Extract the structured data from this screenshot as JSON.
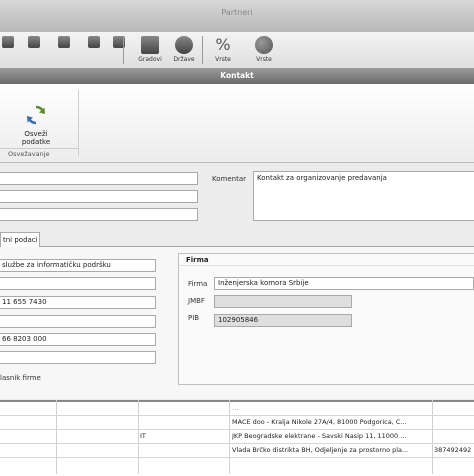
{
  "background_app": {
    "title": "Partneri",
    "ribbon": [
      {
        "label": "",
        "icon": "button-icon"
      },
      {
        "label": "",
        "icon": "button-icon"
      },
      {
        "label": "",
        "icon": "button-icon"
      },
      {
        "label": "",
        "icon": "button-icon"
      },
      {
        "label": "",
        "icon": "button-icon"
      },
      {
        "label": "Gradovi",
        "icon": "buildings-icon"
      },
      {
        "label": "Države",
        "icon": "globe-icon"
      },
      {
        "label": "Vrste",
        "icon": "percent-icon"
      },
      {
        "label": "Vrste",
        "icon": "people-icon"
      }
    ]
  },
  "dialog": {
    "title": "Kontakt",
    "ribbon": {
      "refresh_label": "Osveži podatke",
      "group_label": "Osvežavanje"
    },
    "top": {
      "komentar_label": "Komentar",
      "komentar_value": "Kontakt za organizovanje predavanja",
      "field1": "",
      "field2": "",
      "field3": ""
    },
    "tab": {
      "label": "tni podaci"
    },
    "left": {
      "f1": "službe za informatičku podršku",
      "f2": "",
      "f3": "11 655 7430",
      "f4": "",
      "f5": "66 8203 000",
      "f6": "",
      "footer_label": "lasnik firme"
    },
    "firma": {
      "heading": "Firma",
      "firma_label": "Firma",
      "firma_value": "Inženjerska komora Srbije",
      "jmbf_label": "JMBF",
      "jmbf_value": "",
      "pib_label": "PIB",
      "pib_value": "102905846"
    }
  },
  "grid": {
    "rows": [
      {
        "c3": "",
        "c4": "…",
        "c5": ""
      },
      {
        "c3": "",
        "c4": "MACE doo - Kralja Nikole 27A/4, 81000 Podgorica, C...",
        "c5": ""
      },
      {
        "c3": "IT",
        "c4": "JKP Beogradske elektrane - Savski Nasip 11, 11000 ...",
        "c5": ""
      },
      {
        "c3": "",
        "c4": "Vlada Brčko distrikta BH, Odjeljenje za prostorno pla...",
        "c5": "387492492"
      }
    ]
  }
}
